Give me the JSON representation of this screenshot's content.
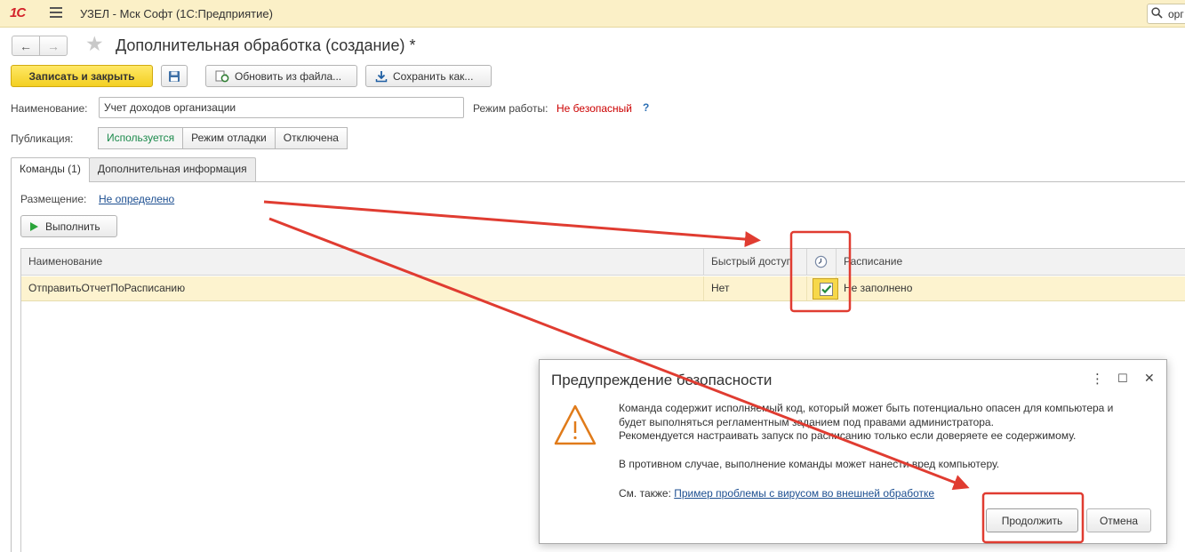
{
  "titlebar": {
    "logo": "1С",
    "title": "УЗЕЛ - Мск Софт  (1С:Предприятие)",
    "search_text": "орг"
  },
  "header": {
    "title": "Дополнительная обработка (создание) *",
    "save_close": "Записать и закрыть",
    "reload": "Обновить из файла...",
    "save_as": "Сохранить как..."
  },
  "fields": {
    "name_label": "Наименование:",
    "name_value": "Учет доходов организации",
    "mode_label": "Режим работы:",
    "mode_value": "Не безопасный",
    "help": "?",
    "publication_label": "Публикация:",
    "publication_options": [
      "Используется",
      "Режим отладки",
      "Отключена"
    ]
  },
  "tabs": [
    "Команды (1)",
    "Дополнительная информация"
  ],
  "commands": {
    "placement_label": "Размещение:",
    "placement_value": "Не определено",
    "run_button": "Выполнить",
    "columns": [
      "Наименование",
      "Быстрый доступ",
      "Расписание"
    ],
    "rows": [
      {
        "name": "ОтправитьОтчетПоРасписанию",
        "quick": "Нет",
        "scheduled": true,
        "schedule": "Не заполнено"
      }
    ]
  },
  "dialog": {
    "title": "Предупреждение безопасности",
    "line1": "Команда содержит исполняемый код, который может быть потенциально опасен для компьютера и",
    "line2": "будет выполняться регламентным заданием под правами администратора.",
    "line3": "Рекомендуется настраивать запуск по расписанию только если доверяете ее содержимому.",
    "line4": "В противном случае, выполнение команды может нанести вред компьютеру.",
    "see_label": "См. также:",
    "see_link": "Пример проблемы с вирусом во внешней обработке",
    "continue": "Продолжить",
    "cancel": "Отмена",
    "menu_glyph": "⋮",
    "maximize_glyph": "☐",
    "close_glyph": "✕"
  },
  "colors": {
    "titlebar_bg": "#fbf0c7",
    "primary_button": "#f3cf22",
    "danger_text": "#cc0000",
    "selected_row": "#fdf3cf",
    "annotation_red": "#e03c31"
  }
}
